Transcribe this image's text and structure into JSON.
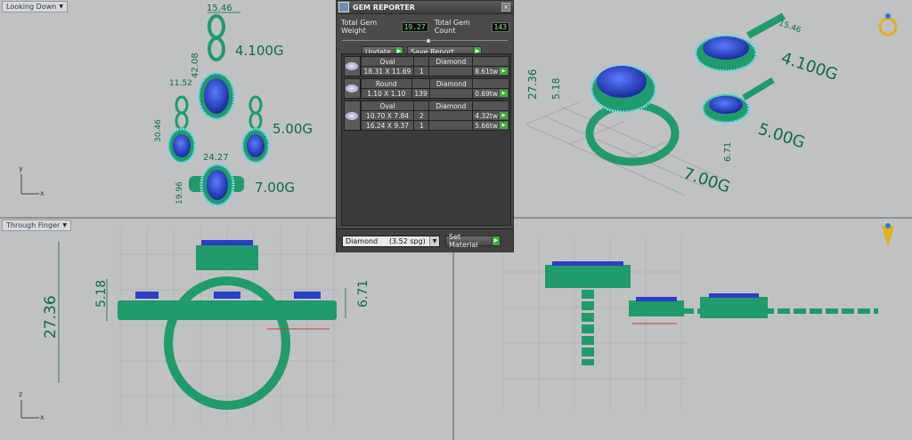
{
  "viewports": {
    "top_left": {
      "label": "Looking Down",
      "dims": [
        "15.46",
        "42.08",
        "11.52",
        "30.46",
        "24.27",
        "19.96"
      ],
      "weights": [
        "4.100G",
        "5.00G",
        "7.00G"
      ],
      "axis": [
        "y",
        "x"
      ]
    },
    "top_right": {
      "dims": [
        "27.36",
        "5.18",
        "6.71",
        "15.46"
      ],
      "weights": [
        "4.100G",
        "5.00G",
        "7.00G"
      ]
    },
    "bottom_left": {
      "label": "Through Finger",
      "dims": [
        "27.36",
        "5.18",
        "6.71"
      ],
      "axis": [
        "z",
        "x"
      ]
    },
    "bottom_right": {}
  },
  "dialog": {
    "title": "GEM REPORTER",
    "total_weight_label": "Total Gem Weight",
    "total_weight": "19.27",
    "total_count_label": "Total Gem Count",
    "total_count": "143",
    "update_label": "Update",
    "save_label": "Save Report",
    "gems": [
      {
        "rows": [
          {
            "shape": "Oval",
            "qty": "",
            "mat": "Diamond",
            "tw": ""
          },
          {
            "shape": "18.31 X 11.69",
            "qty": "1",
            "mat": "",
            "tw": "8.61tw"
          }
        ]
      },
      {
        "rows": [
          {
            "shape": "Round",
            "qty": "",
            "mat": "Diamond",
            "tw": ""
          },
          {
            "shape": "1.10 X 1.10",
            "qty": "139",
            "mat": "",
            "tw": "0.69tw"
          }
        ]
      },
      {
        "rows": [
          {
            "shape": "Oval",
            "qty": "",
            "mat": "Diamond",
            "tw": ""
          },
          {
            "shape": "10.70 X 7.84",
            "qty": "2",
            "mat": "",
            "tw": "4.32tw"
          },
          {
            "shape": "16.24 X 9.37",
            "qty": "1",
            "mat": "",
            "tw": "5.66tw"
          }
        ]
      }
    ],
    "material_value": "Diamond     (3.52 spg)",
    "set_material_label": "Set Material"
  },
  "colors": {
    "metal": "#1f9b6c",
    "gem": "#2a3fc4",
    "dim": "#0e6b4b",
    "pave": "#7fd8e8"
  }
}
